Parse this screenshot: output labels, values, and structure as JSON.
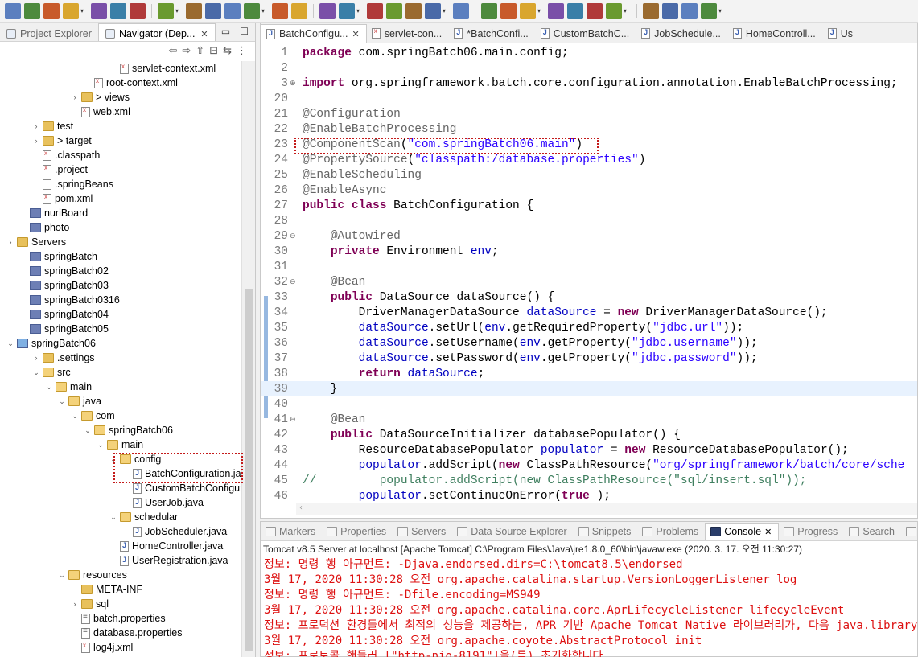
{
  "toolbar": {
    "buttons": [
      "new",
      "save",
      "save-all",
      "print",
      "run-debug",
      "skip-all-breakpoints",
      "resume",
      "suspend",
      "terminate",
      "disconnect",
      "step-into",
      "step-over",
      "step-return",
      "open-type",
      "open-task",
      "search",
      "format",
      "toggle-comment",
      "show-whitespace",
      "debug",
      "run",
      "coverage",
      "ant",
      "server-start",
      "server-stop",
      "new-wizard",
      "new-java-class",
      "open-folder",
      "pin",
      "globe",
      "back",
      "forward"
    ]
  },
  "left_panel": {
    "tabs": [
      {
        "label": "Project Explorer",
        "active": false
      },
      {
        "label": "Navigator (Dep...",
        "active": true
      }
    ],
    "tree": [
      {
        "label": "servlet-context.xml",
        "icon": "xml",
        "indent": 8,
        "twist": ""
      },
      {
        "label": "root-context.xml",
        "icon": "xml",
        "indent": 6,
        "twist": ""
      },
      {
        "label": "> views",
        "icon": "folder",
        "indent": 5,
        "twist": "›"
      },
      {
        "label": "web.xml",
        "icon": "xml",
        "indent": 5,
        "twist": ""
      },
      {
        "label": "test",
        "icon": "folder",
        "indent": 2,
        "twist": "›"
      },
      {
        "label": "> target",
        "icon": "folder",
        "indent": 2,
        "twist": "›"
      },
      {
        "label": ".classpath",
        "icon": "xml",
        "indent": 2,
        "twist": ""
      },
      {
        "label": ".project",
        "icon": "xml",
        "indent": 2,
        "twist": ""
      },
      {
        "label": ".springBeans",
        "icon": "file",
        "indent": 2,
        "twist": ""
      },
      {
        "label": "pom.xml",
        "icon": "xml",
        "indent": 2,
        "twist": ""
      },
      {
        "label": "nuriBoard",
        "icon": "project",
        "indent": 1,
        "twist": ""
      },
      {
        "label": "photo",
        "icon": "project",
        "indent": 1,
        "twist": ""
      },
      {
        "label": "Servers",
        "icon": "folder",
        "indent": 0,
        "twist": "›"
      },
      {
        "label": "springBatch",
        "icon": "project",
        "indent": 1,
        "twist": ""
      },
      {
        "label": "springBatch02",
        "icon": "project",
        "indent": 1,
        "twist": ""
      },
      {
        "label": "springBatch03",
        "icon": "project",
        "indent": 1,
        "twist": ""
      },
      {
        "label": "springBatch0316",
        "icon": "project",
        "indent": 1,
        "twist": ""
      },
      {
        "label": "springBatch04",
        "icon": "project",
        "indent": 1,
        "twist": ""
      },
      {
        "label": "springBatch05",
        "icon": "project",
        "indent": 1,
        "twist": ""
      },
      {
        "label": "springBatch06",
        "icon": "project-open",
        "indent": 0,
        "twist": "⌄"
      },
      {
        "label": ".settings",
        "icon": "folder",
        "indent": 2,
        "twist": "›"
      },
      {
        "label": "src",
        "icon": "folder-open",
        "indent": 2,
        "twist": "⌄"
      },
      {
        "label": "main",
        "icon": "folder-open",
        "indent": 3,
        "twist": "⌄"
      },
      {
        "label": "java",
        "icon": "folder-open",
        "indent": 4,
        "twist": "⌄"
      },
      {
        "label": "com",
        "icon": "folder-open",
        "indent": 5,
        "twist": "⌄"
      },
      {
        "label": "springBatch06",
        "icon": "folder-open",
        "indent": 6,
        "twist": "⌄"
      },
      {
        "label": "main",
        "icon": "folder-open",
        "indent": 7,
        "twist": "⌄"
      },
      {
        "label": "config",
        "icon": "folder-open",
        "indent": 8,
        "twist": "⌄"
      },
      {
        "label": "BatchConfiguration.java",
        "icon": "java",
        "indent": 9,
        "twist": ""
      },
      {
        "label": "CustomBatchConfigurer",
        "icon": "java",
        "indent": 9,
        "twist": ""
      },
      {
        "label": "UserJob.java",
        "icon": "java",
        "indent": 9,
        "twist": ""
      },
      {
        "label": "schedular",
        "icon": "folder-open",
        "indent": 8,
        "twist": "⌄"
      },
      {
        "label": "JobScheduler.java",
        "icon": "java",
        "indent": 9,
        "twist": ""
      },
      {
        "label": "HomeController.java",
        "icon": "java",
        "indent": 8,
        "twist": ""
      },
      {
        "label": "UserRegistration.java",
        "icon": "java",
        "indent": 8,
        "twist": ""
      },
      {
        "label": "resources",
        "icon": "folder-open",
        "indent": 4,
        "twist": "⌄"
      },
      {
        "label": "META-INF",
        "icon": "folder",
        "indent": 5,
        "twist": ""
      },
      {
        "label": "sql",
        "icon": "folder",
        "indent": 5,
        "twist": "›"
      },
      {
        "label": "batch.properties",
        "icon": "props",
        "indent": 5,
        "twist": ""
      },
      {
        "label": "database.properties",
        "icon": "props",
        "indent": 5,
        "twist": ""
      },
      {
        "label": "log4j.xml",
        "icon": "xml",
        "indent": 5,
        "twist": ""
      }
    ]
  },
  "editor": {
    "tabs": [
      {
        "label": "BatchConfigu...",
        "icon": "java",
        "active": true,
        "closable": true
      },
      {
        "label": "servlet-con...",
        "icon": "xml",
        "active": false,
        "closable": false
      },
      {
        "label": "*BatchConfi...",
        "icon": "java",
        "active": false,
        "closable": false
      },
      {
        "label": "CustomBatchC...",
        "icon": "java",
        "active": false,
        "closable": false
      },
      {
        "label": "JobSchedule...",
        "icon": "java",
        "active": false,
        "closable": false
      },
      {
        "label": "HomeControll...",
        "icon": "java",
        "active": false,
        "closable": false
      },
      {
        "label": "Us",
        "icon": "java",
        "active": false,
        "closable": false
      }
    ],
    "lines": [
      {
        "n": "1",
        "fold": "",
        "tokens": [
          [
            "kw",
            "package"
          ],
          [
            "",
            "com.springBatch06.main.config;"
          ]
        ]
      },
      {
        "n": "2",
        "fold": "",
        "tokens": []
      },
      {
        "n": "3",
        "fold": "⊕",
        "tokens": [
          [
            "kw",
            "import"
          ],
          [
            "",
            "org.springframework.batch.core.configuration.annotation.EnableBatchProcessing;"
          ]
        ]
      },
      {
        "n": "20",
        "fold": "",
        "tokens": []
      },
      {
        "n": "21",
        "fold": "",
        "tokens": [
          [
            "ann",
            "@Configuration"
          ]
        ]
      },
      {
        "n": "22",
        "fold": "",
        "tokens": [
          [
            "ann",
            "@EnableBatchProcessing"
          ]
        ]
      },
      {
        "n": "23",
        "fold": "",
        "tokens": [
          [
            "ann",
            "@ComponentScan"
          ],
          [
            "",
            "("
          ],
          [
            "str",
            "\"com.springBatch06.main\""
          ],
          [
            "",
            ")"
          ]
        ]
      },
      {
        "n": "24",
        "fold": "",
        "tokens": [
          [
            "ann",
            "@PropertySource"
          ],
          [
            "",
            "("
          ],
          [
            "str",
            "\"classpath:/database.properties\""
          ],
          [
            "",
            ")"
          ]
        ]
      },
      {
        "n": "25",
        "fold": "",
        "tokens": [
          [
            "ann",
            "@EnableScheduling"
          ]
        ]
      },
      {
        "n": "26",
        "fold": "",
        "tokens": [
          [
            "ann",
            "@EnableAsync"
          ]
        ]
      },
      {
        "n": "27",
        "fold": "",
        "tokens": [
          [
            "kw",
            "public class"
          ],
          [
            "",
            " BatchConfiguration {"
          ]
        ]
      },
      {
        "n": "28",
        "fold": "",
        "tokens": []
      },
      {
        "n": "29",
        "fold": "⊖",
        "tokens": [
          [
            "",
            "    "
          ],
          [
            "ann",
            "@Autowired"
          ]
        ]
      },
      {
        "n": "30",
        "fold": "",
        "tokens": [
          [
            "",
            "    "
          ],
          [
            "kw",
            "private"
          ],
          [
            "",
            " Environment "
          ],
          [
            "fld",
            "env"
          ],
          [
            "",
            ";"
          ]
        ]
      },
      {
        "n": "31",
        "fold": "",
        "tokens": []
      },
      {
        "n": "32",
        "fold": "⊖",
        "tokens": [
          [
            "",
            "    "
          ],
          [
            "ann",
            "@Bean"
          ]
        ]
      },
      {
        "n": "33",
        "fold": "",
        "tokens": [
          [
            "",
            "    "
          ],
          [
            "kw",
            "public"
          ],
          [
            "",
            " DataSource dataSource() {"
          ]
        ]
      },
      {
        "n": "34",
        "fold": "",
        "tokens": [
          [
            "",
            "        DriverManagerDataSource "
          ],
          [
            "fld",
            "dataSource"
          ],
          [
            "",
            " = "
          ],
          [
            "kw",
            "new"
          ],
          [
            "",
            " DriverManagerDataSource();"
          ]
        ]
      },
      {
        "n": "35",
        "fold": "",
        "tokens": [
          [
            "",
            "        "
          ],
          [
            "fld",
            "dataSource"
          ],
          [
            "",
            ".setUrl("
          ],
          [
            "fld",
            "env"
          ],
          [
            "",
            ".getRequiredProperty("
          ],
          [
            "str",
            "\"jdbc.url\""
          ],
          [
            "",
            "));"
          ]
        ]
      },
      {
        "n": "36",
        "fold": "",
        "tokens": [
          [
            "",
            "        "
          ],
          [
            "fld",
            "dataSource"
          ],
          [
            "",
            ".setUsername("
          ],
          [
            "fld",
            "env"
          ],
          [
            "",
            ".getProperty("
          ],
          [
            "str",
            "\"jdbc.username\""
          ],
          [
            "",
            "));"
          ]
        ]
      },
      {
        "n": "37",
        "fold": "",
        "tokens": [
          [
            "",
            "        "
          ],
          [
            "fld",
            "dataSource"
          ],
          [
            "",
            ".setPassword("
          ],
          [
            "fld",
            "env"
          ],
          [
            "",
            ".getProperty("
          ],
          [
            "str",
            "\"jdbc.password\""
          ],
          [
            "",
            "));"
          ]
        ]
      },
      {
        "n": "38",
        "fold": "",
        "tokens": [
          [
            "",
            "        "
          ],
          [
            "kw",
            "return"
          ],
          [
            "",
            " "
          ],
          [
            "fld",
            "dataSource"
          ],
          [
            "",
            ";"
          ]
        ]
      },
      {
        "n": "39",
        "fold": "",
        "tokens": [
          [
            "",
            "    }"
          ]
        ]
      },
      {
        "n": "40",
        "fold": "",
        "tokens": []
      },
      {
        "n": "41",
        "fold": "⊖",
        "tokens": [
          [
            "",
            "    "
          ],
          [
            "ann",
            "@Bean"
          ]
        ]
      },
      {
        "n": "42",
        "fold": "",
        "tokens": [
          [
            "",
            "    "
          ],
          [
            "kw",
            "public"
          ],
          [
            "",
            " DataSourceInitializer databasePopulator() {"
          ]
        ]
      },
      {
        "n": "43",
        "fold": "",
        "tokens": [
          [
            "",
            "        ResourceDatabasePopulator "
          ],
          [
            "fld",
            "populator"
          ],
          [
            "",
            " = "
          ],
          [
            "kw",
            "new"
          ],
          [
            "",
            " ResourceDatabasePopulator();"
          ]
        ]
      },
      {
        "n": "44",
        "fold": "",
        "tokens": [
          [
            "",
            "        "
          ],
          [
            "fld",
            "populator"
          ],
          [
            "",
            ".addScript("
          ],
          [
            "kw",
            "new"
          ],
          [
            "",
            " ClassPathResource("
          ],
          [
            "str",
            "\"org/springframework/batch/core/sche"
          ]
        ]
      },
      {
        "n": "45",
        "fold": "",
        "tokens": [
          [
            "cmt",
            "//         populator.addScript(new ClassPathResource(\"sql/insert.sql\"));"
          ]
        ]
      },
      {
        "n": "46",
        "fold": "",
        "tokens": [
          [
            "",
            "        "
          ],
          [
            "fld",
            "populator"
          ],
          [
            "",
            ".setContinueOnError("
          ],
          [
            "kw",
            "true"
          ],
          [
            "",
            ");"
          ]
        ]
      }
    ]
  },
  "console": {
    "tabs": [
      {
        "label": "Markers",
        "active": false
      },
      {
        "label": "Properties",
        "active": false
      },
      {
        "label": "Servers",
        "active": false
      },
      {
        "label": "Data Source Explorer",
        "active": false
      },
      {
        "label": "Snippets",
        "active": false
      },
      {
        "label": "Problems",
        "active": false
      },
      {
        "label": "Console",
        "active": true
      },
      {
        "label": "Progress",
        "active": false
      },
      {
        "label": "Search",
        "active": false
      },
      {
        "label": "Git Rep",
        "active": false
      }
    ],
    "title": "Tomcat v8.5 Server at localhost [Apache Tomcat] C:\\Program Files\\Java\\jre1.8.0_60\\bin\\javaw.exe (2020. 3. 17. 오전 11:30:27)",
    "lines": [
      "정보: 명령 행 아규먼트: -Djava.endorsed.dirs=C:\\tomcat8.5\\endorsed",
      "3월 17, 2020 11:30:28 오전 org.apache.catalina.startup.VersionLoggerListener log",
      "정보: 명령 행 아규먼트: -Dfile.encoding=MS949",
      "3월 17, 2020 11:30:28 오전 org.apache.catalina.core.AprLifecycleListener lifecycleEvent",
      "정보: 프로덕션 환경들에서 최적의 성능을 제공하는, APR 기반 Apache Tomcat Native 라이브러리가, 다음 java.library.path",
      "3월 17, 2020 11:30:28 오전 org.apache.coyote.AbstractProtocol init",
      "정보: 프로토콜 핸들러 [\"http-nio-8191\"]을(를) 초기화합니다"
    ]
  },
  "colors": {
    "keyword": "#7f0055",
    "annotation": "#646464",
    "string": "#2a00ff",
    "field": "#0000c0",
    "comment": "#3f7f5f",
    "console_text": "#dd1111",
    "highlight_box": "#c41a1a"
  }
}
